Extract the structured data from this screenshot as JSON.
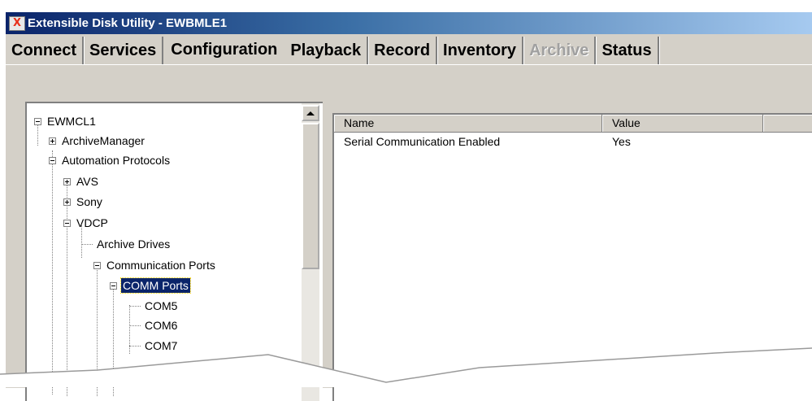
{
  "window": {
    "title": "Extensible Disk Utility - EWBMLE1",
    "app_icon_letter": "X"
  },
  "tabs": [
    {
      "label": "Connect",
      "state": "normal"
    },
    {
      "label": "Services",
      "state": "normal"
    },
    {
      "label": "Configuration",
      "state": "selected"
    },
    {
      "label": "Playback",
      "state": "normal"
    },
    {
      "label": "Record",
      "state": "normal"
    },
    {
      "label": "Inventory",
      "state": "normal"
    },
    {
      "label": "Archive",
      "state": "disabled"
    },
    {
      "label": "Status",
      "state": "normal"
    }
  ],
  "tree": {
    "root": {
      "label": "EWMCL1",
      "expanded": true
    },
    "archive_manager": {
      "label": "ArchiveManager",
      "expanded": false
    },
    "automation_protocols": {
      "label": "Automation Protocols",
      "expanded": true
    },
    "avs": {
      "label": "AVS",
      "expanded": false
    },
    "sony": {
      "label": "Sony",
      "expanded": false
    },
    "vdcp": {
      "label": "VDCP",
      "expanded": true
    },
    "archive_drives": {
      "label": "Archive Drives"
    },
    "communication_ports": {
      "label": "Communication Ports",
      "expanded": true
    },
    "comm_ports": {
      "label": "COMM Ports",
      "expanded": true,
      "selected": true
    },
    "com5": {
      "label": "COM5"
    },
    "com6": {
      "label": "COM6"
    },
    "com7": {
      "label": "COM7"
    }
  },
  "list": {
    "columns": [
      "Name",
      "Value",
      ""
    ],
    "rows": [
      {
        "name": "Serial Communication Enabled",
        "value": "Yes"
      }
    ]
  },
  "colors": {
    "title_bar_start": "#0a246a",
    "title_bar_end": "#a6caf0",
    "selection": "#0a246a",
    "window_face": "#d4d0c8"
  }
}
